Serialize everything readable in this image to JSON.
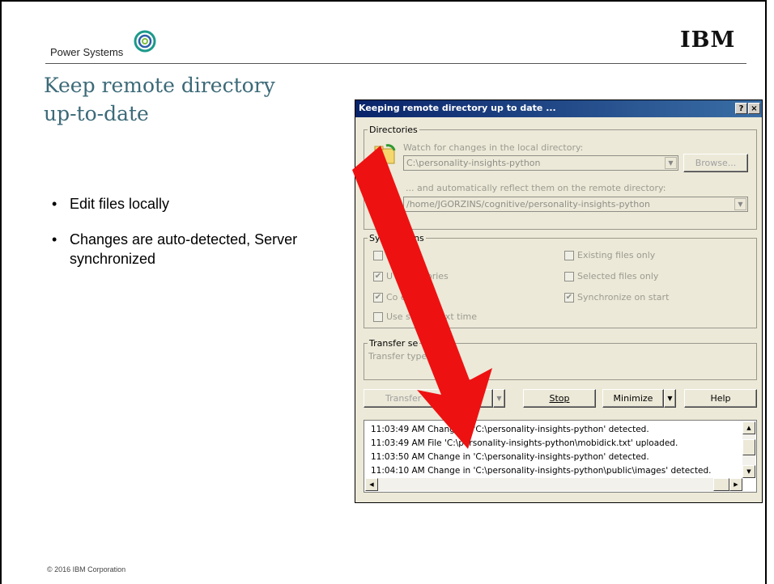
{
  "slide": {
    "brand": "Power Systems",
    "company_logo": "IBM",
    "title": "Keep remote directory up-to-date",
    "bullets": [
      "Edit files locally",
      "Changes are auto-detected, Server synchronized"
    ],
    "copyright": "© 2016 IBM Corporation"
  },
  "dialog": {
    "title": "Keeping remote directory up to date ...",
    "title_buttons": {
      "help": "?",
      "close": "×"
    },
    "directories": {
      "group_label": "Directories",
      "local_label": "Watch for changes in the local directory:",
      "local_value": "C:\\personality-insights-python",
      "browse": "Browse...",
      "remote_label": "... and automatically reflect them on the remote directory:",
      "remote_value": "/home/JGORZINS/cognitive/personality-insights-python"
    },
    "sync": {
      "group_label": "Sy        e options",
      "options_left": [
        {
          "label": "      iles",
          "checked": false
        },
        {
          "label": "U         bdirectories",
          "checked": true
        },
        {
          "label": "Co          error",
          "checked": true
        },
        {
          "label": "Use s         ions next time",
          "checked": false
        }
      ],
      "options_right": [
        {
          "label": "Existing files only",
          "checked": false
        },
        {
          "label": "Selected files only",
          "checked": false
        },
        {
          "label": "Synchronize on start",
          "checked": true
        }
      ]
    },
    "transfer": {
      "group_label": "Transfer se",
      "type_label": "Transfer type"
    },
    "buttons": {
      "transfer_settings": "Transfer",
      "stop": "Stop",
      "minimize": "Minimize",
      "help": "Help"
    },
    "log": [
      "11:03:49 AM  Change in 'C:\\personality-insights-python' detected.",
      "11:03:49 AM  File 'C:\\personality-insights-python\\mobidick.txt' uploaded.",
      "11:03:50 AM  Change in 'C:\\personality-insights-python' detected.",
      "11:04:10 AM  Change in 'C:\\personality-insights-python\\public\\images' detected."
    ]
  },
  "colors": {
    "title_teal": "#3c6a78",
    "arrow_red": "#ee1111",
    "dialog_bg": "#ece9d8",
    "titlebar": "#0a246a"
  }
}
